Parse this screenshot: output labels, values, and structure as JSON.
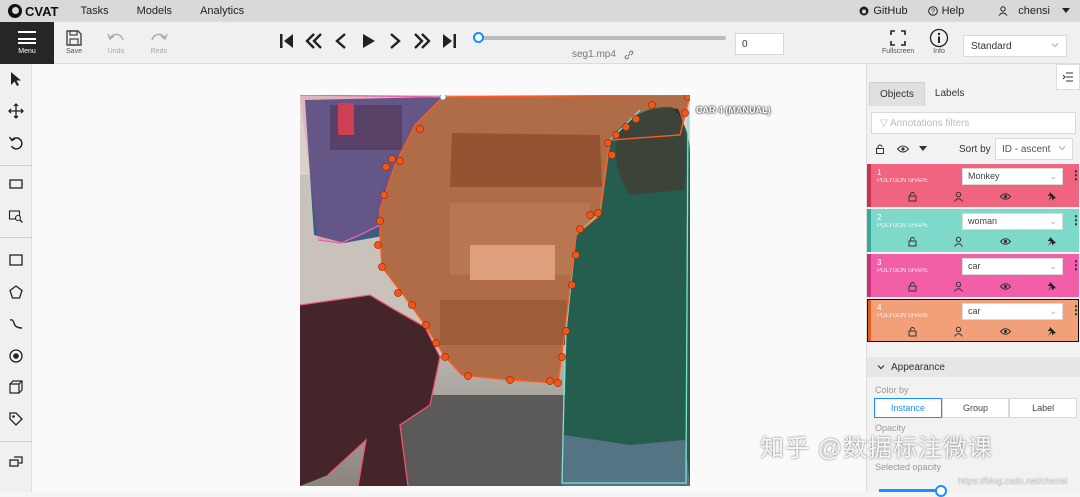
{
  "app": {
    "name": "CVAT"
  },
  "topnav": [
    "Tasks",
    "Models",
    "Analytics"
  ],
  "topright": {
    "github": "GitHub",
    "help": "Help",
    "user": "chensi"
  },
  "toolbar": {
    "menu": "Menu",
    "save": "Save",
    "undo": "Undo",
    "redo": "Redo",
    "filename": "seg1.mp4",
    "frame": "0",
    "fullscreen": "Fullscreen",
    "info": "Info",
    "view": "Standard"
  },
  "canvas": {
    "active_label": "CAR 4 (MANUAL)"
  },
  "sidebar": {
    "tabs": [
      "Objects",
      "Labels"
    ],
    "filter_placeholder": "Annotations filters",
    "sort_by": "Sort by",
    "sort_value": "ID - ascent",
    "objects": [
      {
        "id": "1",
        "type": "POLYGON SHAPE",
        "label": "Monkey",
        "color": "#f06480"
      },
      {
        "id": "2",
        "type": "POLYGON SHAPE",
        "label": "woman",
        "color": "#7fd9cb"
      },
      {
        "id": "3",
        "type": "POLYGON SHAPE",
        "label": "car",
        "color": "#f25fa8"
      },
      {
        "id": "4",
        "type": "POLYGON SHAPE",
        "label": "car",
        "color": "#f2a07a"
      }
    ],
    "appearance": "Appearance",
    "color_by": "Color by",
    "color_options": [
      "Instance",
      "Group",
      "Label"
    ],
    "opacity": "Opacity",
    "selected_opacity": "Selected opacity"
  },
  "watermark": {
    "text": "知乎 @数据标注微课",
    "url": "https://blog.csdn.net/chensi"
  }
}
